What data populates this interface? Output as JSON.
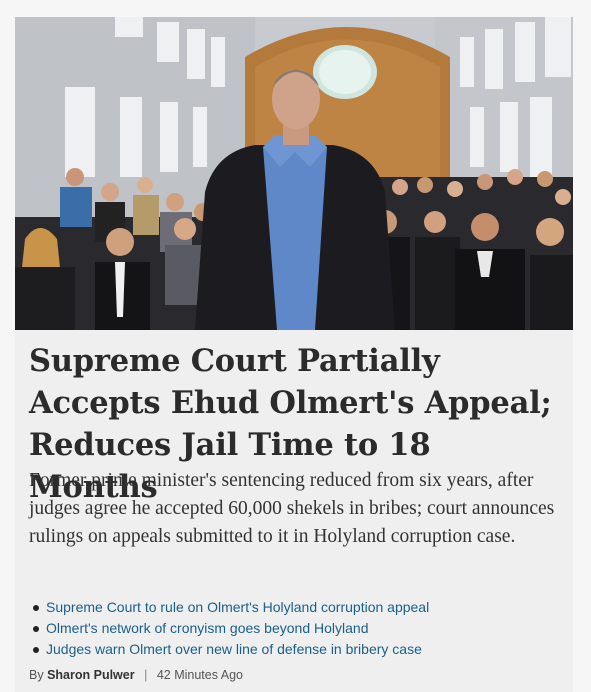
{
  "article": {
    "headline": "Supreme Court Partially Accepts Ehud Olmert's Appeal; Reduces Jail Time to 18 Months",
    "subhead": "Former prime minister's sentencing reduced from six years, after judges agree he accepted 60,000 shekels in bribes; court announces rulings on appeals submitted to it in Holyland corruption case.",
    "related": [
      "Supreme Court to rule on Olmert's Holyland corruption appeal",
      "Olmert's network of cronyism goes beyond Holyland",
      "Judges warn Olmert over new line of defense in bribery case"
    ],
    "byline": {
      "prefix": "By",
      "author": "Sharon Pulwer",
      "separator": "|",
      "time": "42 Minutes Ago"
    }
  },
  "photo": {
    "subject": "man in dark jacket and blue shirt standing in courtroom",
    "colors": {
      "wall": "#c9ccd0",
      "wood": "#b77a3a",
      "jacket": "#1b1b1f",
      "shirt": "#5b84c6"
    }
  },
  "colors": {
    "link": "#1a5f8a",
    "headline": "#2b2b2b",
    "background": "#efefef"
  }
}
